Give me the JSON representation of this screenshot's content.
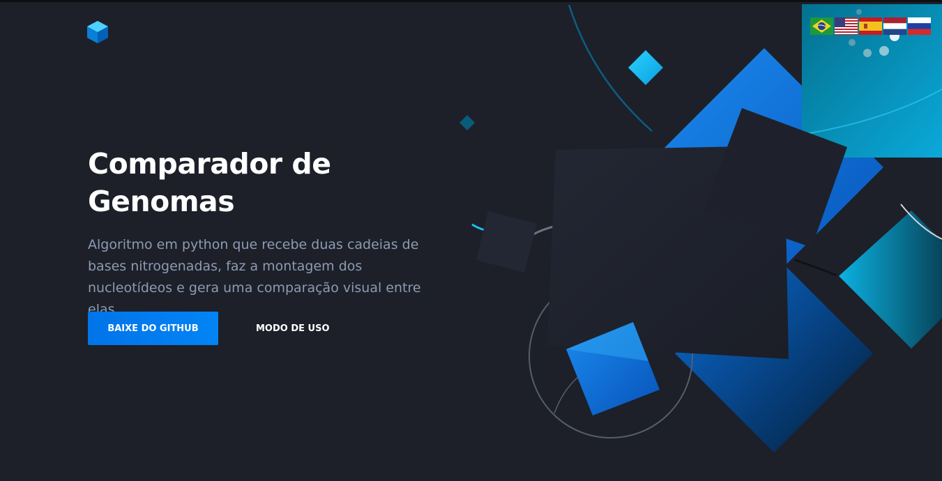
{
  "hero": {
    "title": "Comparador de Genomas",
    "description": "Algoritmo em python que recebe duas cadeias de bases nitrogenadas, faz a montagem dos nucleotídeos e gera uma comparação visual entre elas."
  },
  "buttons": {
    "primary_label": "BAIXE DO GITHUB",
    "secondary_label": "MODO DE USO"
  },
  "languages": [
    {
      "icon": "flag-brazil-icon"
    },
    {
      "icon": "flag-usa-icon"
    },
    {
      "icon": "flag-spain-icon"
    },
    {
      "icon": "flag-netherlands-icon"
    },
    {
      "icon": "flag-russia-icon"
    }
  ],
  "colors": {
    "background": "#1d2029",
    "accent": "#0384f5",
    "text_muted": "#8e9bb2"
  }
}
